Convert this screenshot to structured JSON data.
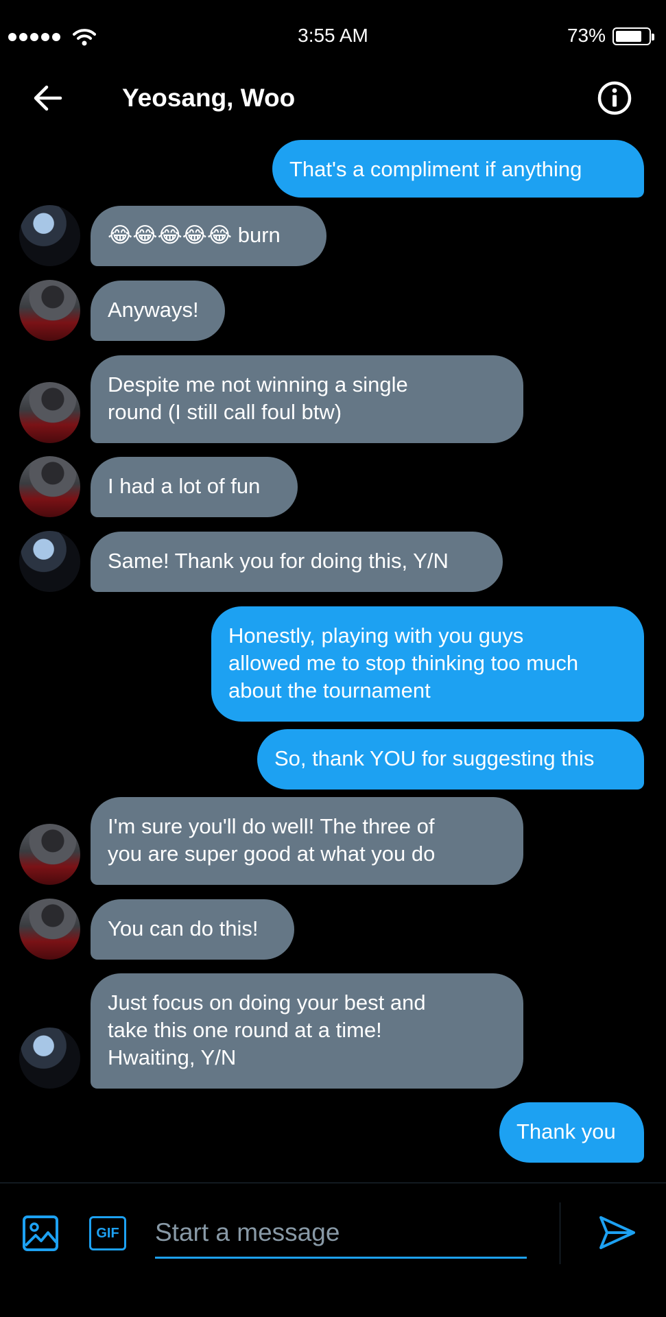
{
  "status_bar": {
    "time": "3:55 AM",
    "battery_percent": "73%",
    "battery_level": 0.73,
    "signal_bars": 5
  },
  "header": {
    "title": "Yeosang, Woo",
    "back_icon": "arrow-left-icon",
    "info_icon": "info-icon"
  },
  "messages": [
    {
      "dir": "out",
      "text": "That's a compliment if anything"
    },
    {
      "dir": "in",
      "avatar": "a",
      "text": "😂😂😂😂😂 burn"
    },
    {
      "dir": "in",
      "avatar": "b",
      "text": "Anyways!"
    },
    {
      "dir": "in",
      "avatar": "b",
      "text": "Despite me not winning a single\nround (I still call foul btw)"
    },
    {
      "dir": "in",
      "avatar": "b",
      "text": "I had a lot of fun"
    },
    {
      "dir": "in",
      "avatar": "a",
      "text": "Same! Thank you for doing this, Y/N"
    },
    {
      "dir": "out",
      "text": "Honestly, playing with you guys\nallowed me to stop thinking too much\nabout the tournament"
    },
    {
      "dir": "out",
      "text": "So, thank YOU for suggesting this"
    },
    {
      "dir": "in",
      "avatar": "b",
      "text": "I'm sure you'll do well! The three of\nyou are super good at what you do"
    },
    {
      "dir": "in",
      "avatar": "b",
      "text": "You can do this!"
    },
    {
      "dir": "in",
      "avatar": "a",
      "text": "Just focus on doing your best and\ntake this one round at a time!\nHwaiting, Y/N"
    },
    {
      "dir": "out",
      "text": "Thank you"
    }
  ],
  "composer": {
    "placeholder": "Start a message",
    "gif_label": "GIF",
    "media_icon": "image-icon",
    "send_icon": "send-icon"
  },
  "colors": {
    "background": "#000000",
    "outgoing_bubble": "#1da1f2",
    "incoming_bubble": "#657786",
    "accent": "#1da1f2"
  }
}
